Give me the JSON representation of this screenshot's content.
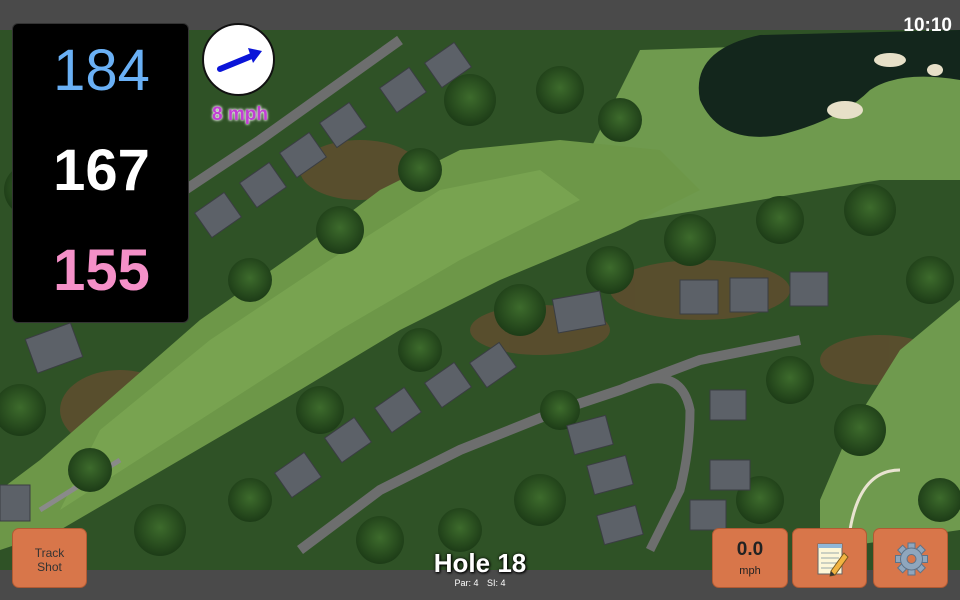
{
  "status": {
    "time": "10:10"
  },
  "distances": {
    "back": "184",
    "middle": "167",
    "front": "155"
  },
  "wind": {
    "speed_label": "8 mph",
    "arrow_color": "#0a14d8"
  },
  "buttons": {
    "track_shot_line1": "Track",
    "track_shot_line2": "Shot",
    "wind_value": "0.0",
    "wind_unit": "mph",
    "notes_icon": "notepad-icon",
    "settings_icon": "gear-icon"
  },
  "hole": {
    "title": "Hole 18",
    "par_label": "Par: 4",
    "si_label": "SI: 4"
  },
  "colors": {
    "button_bg": "#d8764a",
    "back_distance": "#6ab0f5",
    "middle_distance": "#ffffff",
    "front_distance": "#f590c8",
    "wind_label": "#c23fd4"
  }
}
